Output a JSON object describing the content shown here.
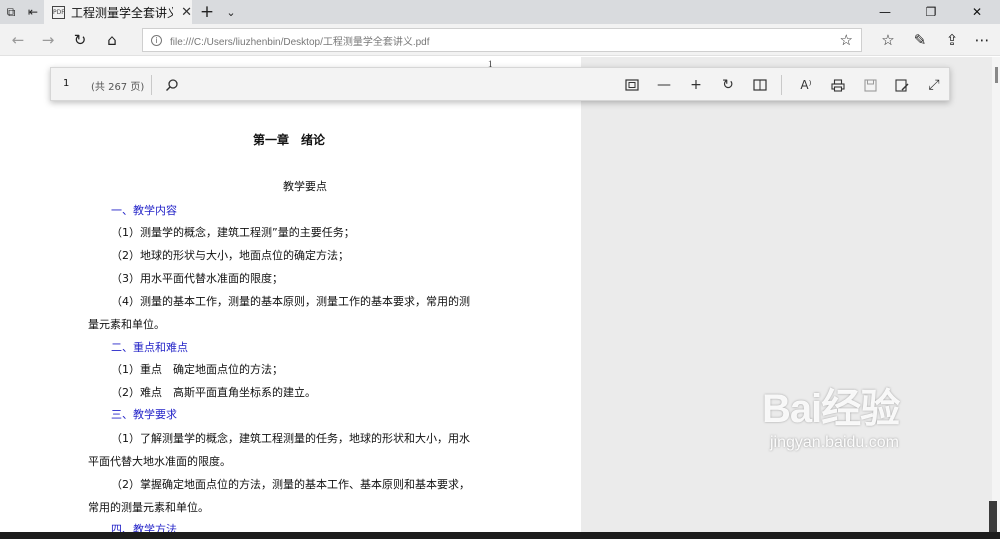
{
  "tabbar": {
    "tab_title": "工程测量学全套讲义.pd",
    "tab_favicon_label": "PDF"
  },
  "navbar": {
    "url": "file:///C:/Users/liuzhenbin/Desktop/工程测量学全套讲义.pdf"
  },
  "pdf_toolbar": {
    "page_value": "1",
    "page_total": "(共 267 页)"
  },
  "page": {
    "top_number": "1",
    "chapter_title": "第一章　绪论",
    "section_title": "教学要点",
    "lines": [
      {
        "text": "一、教学内容",
        "blue": true
      },
      {
        "text": "（1）测量学的概念，建筑工程测”量的主要任务；",
        "blue": false
      },
      {
        "text": "（2）地球的形状与大小，地面点位的确定方法；",
        "blue": false
      },
      {
        "text": "（3）用水平面代替水准面的限度；",
        "blue": false
      },
      {
        "text": "（4）测量的基本工作，测量的基本原则，测量工作的基本要求，常用的测",
        "blue": false
      },
      {
        "text": "量元素和单位。",
        "blue": false
      },
      {
        "text": "二、重点和难点",
        "blue": true
      },
      {
        "text": "（1）重点　确定地面点位的方法；",
        "blue": false
      },
      {
        "text": "（2）难点　高斯平面直角坐标系的建立。",
        "blue": false
      },
      {
        "text": "三、教学要求",
        "blue": true
      },
      {
        "text": "（1）了解测量学的概念，建筑工程测量的任务，地球的形状和大小，用水",
        "blue": false
      },
      {
        "text": "平面代替大地水准面的限度。",
        "blue": false
      },
      {
        "text": "（2）掌握确定地面点位的方法，测量的基本工作、基本原则和基本要求，",
        "blue": false
      },
      {
        "text": "常用的测量元素和单位。",
        "blue": false
      },
      {
        "text": "四、教学方法",
        "blue": true
      }
    ]
  },
  "watermark": {
    "logo": "Bai经验",
    "url": "jingyan.baidu.com"
  },
  "icons": {
    "back": "arrow-left-icon",
    "forward": "arrow-right-icon",
    "refresh": "refresh-icon",
    "home": "home-icon",
    "favorite": "star-icon",
    "favorites_hub": "favorites-hub-icon",
    "pen": "pen-icon",
    "share": "share-icon",
    "more": "more-icon"
  }
}
